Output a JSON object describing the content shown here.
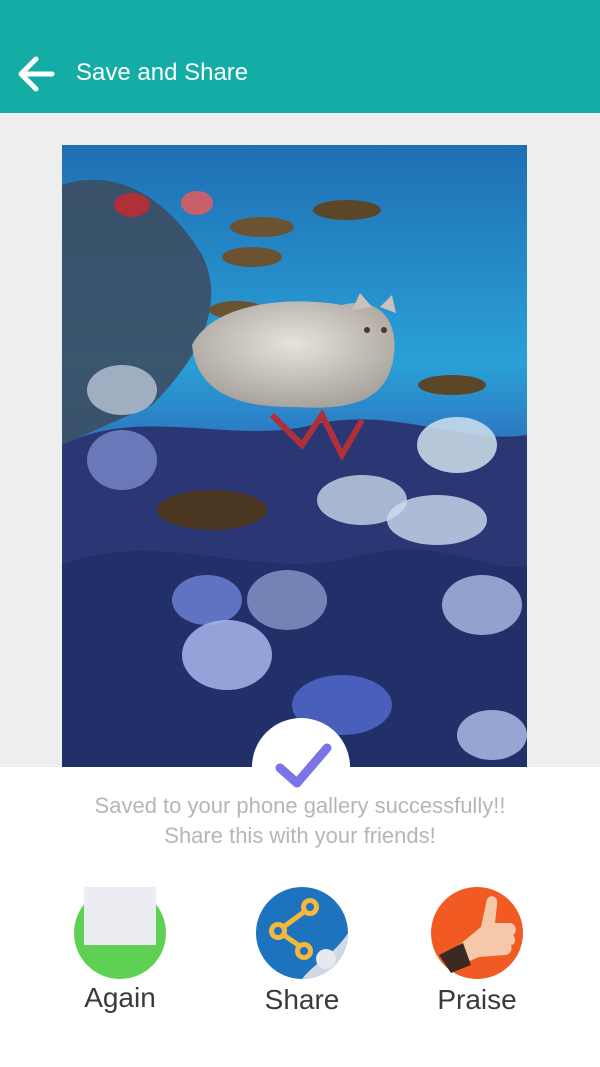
{
  "header": {
    "title": "Save and Share",
    "back_icon": "arrow-left-icon",
    "background": "#14ada5"
  },
  "photo": {
    "content": "collage image"
  },
  "status": {
    "icon": "check-icon",
    "line1": "Saved to your phone gallery successfully!!",
    "line2": "Share this with your friends!",
    "check_color": "#7b74e6"
  },
  "actions": [
    {
      "label": "Again",
      "icon": "again-icon",
      "color": "#5ed155"
    },
    {
      "label": "Share",
      "icon": "share-icon",
      "color": "#1e73be"
    },
    {
      "label": "Praise",
      "icon": "thumbs-up-icon",
      "color": "#f15a22"
    }
  ]
}
